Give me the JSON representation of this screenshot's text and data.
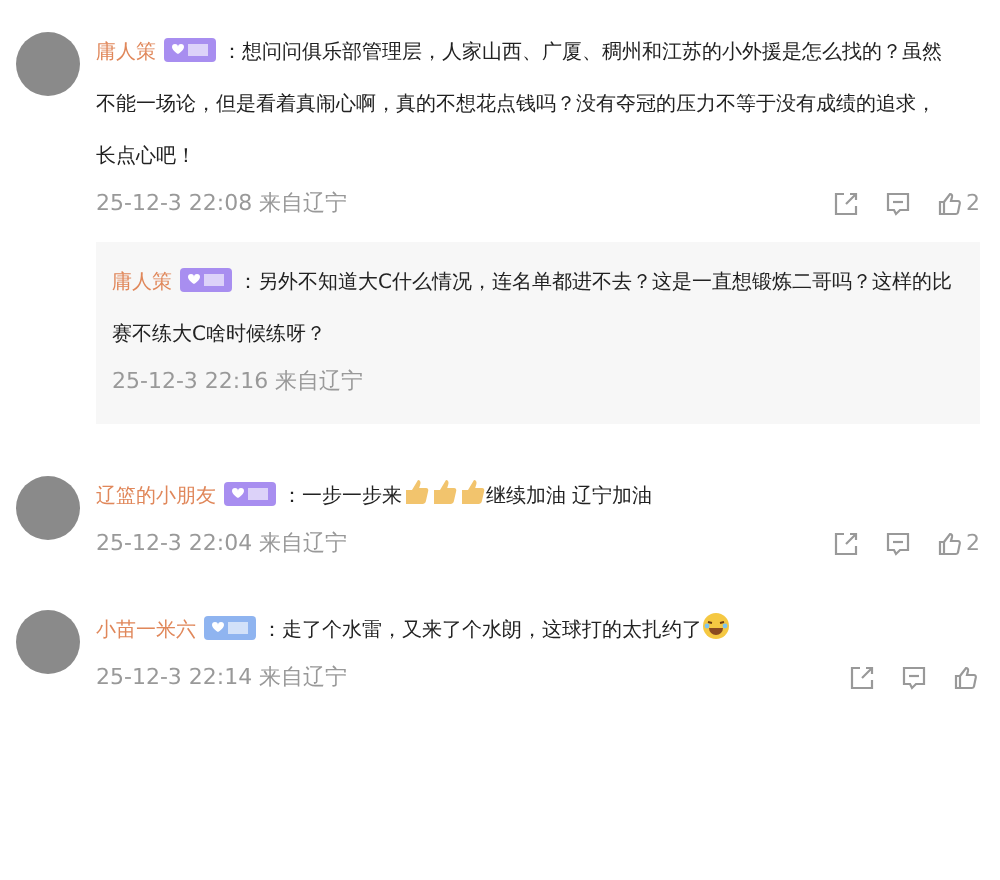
{
  "comments": [
    {
      "author": "庸人策",
      "badge": {
        "color": "#a88ef0"
      },
      "lines": [
        [
          {
            "kind": "text",
            "text": "：想问问俱乐部管理层，人家山西、广厦、稠州和江苏的小外援是怎么找的？虽然"
          }
        ],
        [
          {
            "kind": "text",
            "text": "不能一场论，但是看着真闹心啊，真的不想花点钱吗？没有夺冠的压力不等于没有成绩的追求，"
          }
        ],
        [
          {
            "kind": "text",
            "text": "长点心吧！"
          }
        ]
      ],
      "time": "25-12-3 22:08",
      "location": "来自辽宁",
      "likes": "2",
      "replies": [
        {
          "author": "庸人策",
          "badge": {
            "color": "#a88ef0"
          },
          "lines": [
            [
              {
                "kind": "text",
                "text": "：另外不知道大C什么情况，连名单都进不去？这是一直想锻炼二哥吗？这样的比"
              }
            ],
            [
              {
                "kind": "text",
                "text": "赛不练大C啥时候练呀？"
              }
            ]
          ],
          "time": "25-12-3 22:16",
          "location": "来自辽宁"
        }
      ]
    },
    {
      "author": "辽篮的小朋友",
      "badge": {
        "color": "#a88ef0"
      },
      "lines": [
        [
          {
            "kind": "text",
            "text": "：一步一步来"
          },
          {
            "kind": "thumbs-up"
          },
          {
            "kind": "thumbs-up"
          },
          {
            "kind": "thumbs-up"
          },
          {
            "kind": "text",
            "text": "继续加油 辽宁加油"
          }
        ]
      ],
      "time": "25-12-3 22:04",
      "location": "来自辽宁",
      "likes": "2"
    },
    {
      "author": "小苗一米六",
      "badge": {
        "color": "#8fb4f0"
      },
      "lines": [
        [
          {
            "kind": "text",
            "text": "：走了个水雷，又来了个水朗，这球打的太扎约了"
          },
          {
            "kind": "laugh-cry"
          }
        ]
      ],
      "time": "25-12-3 22:14",
      "location": "来自辽宁"
    }
  ]
}
